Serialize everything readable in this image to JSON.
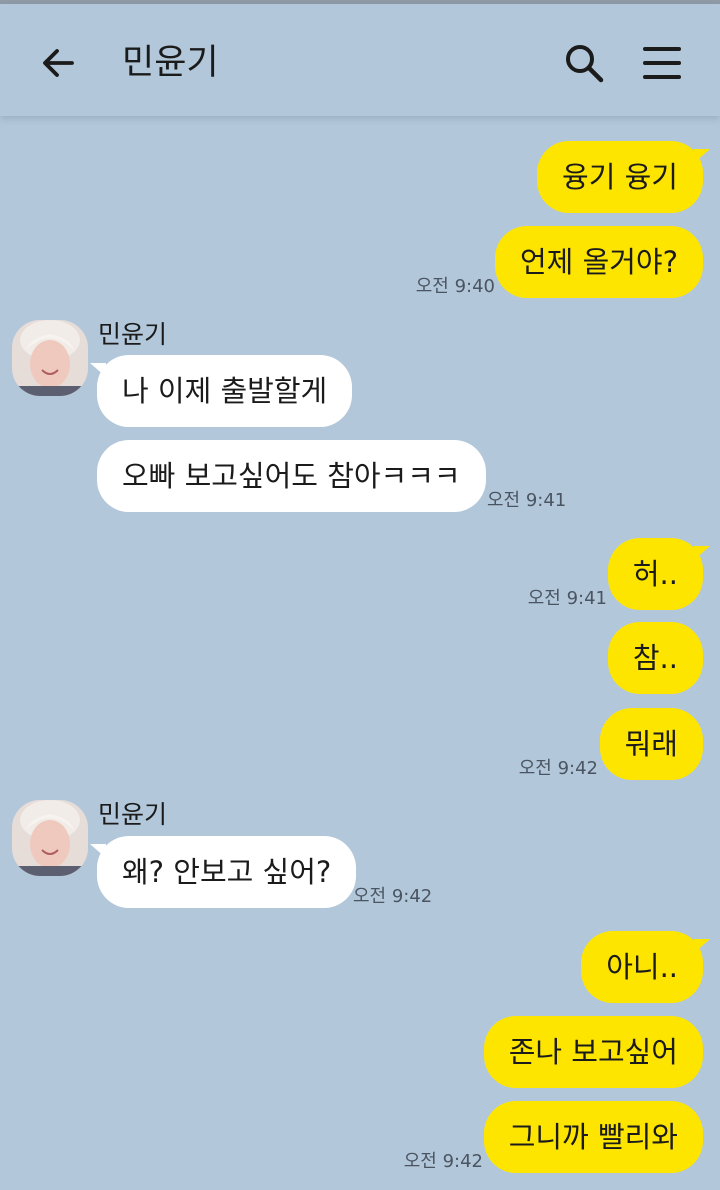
{
  "header": {
    "title": "민윤기",
    "back_icon": "arrow-left-icon",
    "search_icon": "search-icon",
    "menu_icon": "hamburger-menu-icon"
  },
  "colors": {
    "background": "#b2c7da",
    "my_bubble": "#fee500",
    "their_bubble": "#ffffff"
  },
  "messages": [
    {
      "from": "me",
      "text": "융기 융기"
    },
    {
      "from": "me",
      "text": "언제 올거야?",
      "time": "오전 9:40"
    },
    {
      "from": "them",
      "sender": "민윤기",
      "text": "나 이제 출발할게"
    },
    {
      "from": "them",
      "text": "오빠 보고싶어도 참아ㅋㅋㅋ",
      "time": "오전 9:41"
    },
    {
      "from": "me",
      "text": "허..",
      "time": "오전 9:41"
    },
    {
      "from": "me",
      "text": "참.."
    },
    {
      "from": "me",
      "text": "뭐래",
      "time": "오전 9:42"
    },
    {
      "from": "them",
      "sender": "민윤기",
      "text": "왜? 안보고 싶어?",
      "time": "오전 9:42"
    },
    {
      "from": "me",
      "text": "아니.."
    },
    {
      "from": "me",
      "text": "존나 보고싶어"
    },
    {
      "from": "me",
      "text": "그니까 빨리와",
      "time": "오전 9:42"
    }
  ]
}
